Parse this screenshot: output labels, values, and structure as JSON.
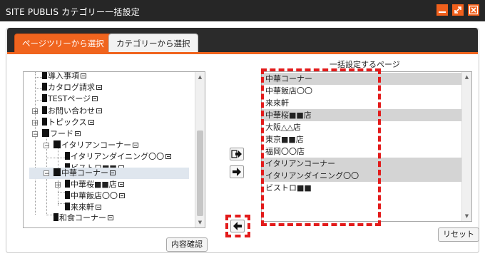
{
  "window": {
    "title": "SITE PUBLIS カテゴリー一括設定",
    "colors": {
      "titlebar": "#262626",
      "accent": "#f0641e",
      "dashed": "#e31b1b"
    }
  },
  "tabs": [
    {
      "label": "ページツリーから選択",
      "active": true
    },
    {
      "label": "カテゴリーから選択",
      "active": false
    }
  ],
  "tree": {
    "items": [
      {
        "label": "導入事項",
        "expander": "",
        "folder": false
      },
      {
        "label": "カタログ請求",
        "expander": "",
        "folder": false
      },
      {
        "label": "TESTページ",
        "expander": "",
        "folder": false
      },
      {
        "label": "お問い合わせ",
        "expander": "+",
        "folder": false
      },
      {
        "label": "トピックス",
        "expander": "+",
        "folder": false
      },
      {
        "label": "フード",
        "expander": "−",
        "folder": true
      },
      {
        "label": "イタリアンコーナー",
        "expander": "−",
        "folder": true
      },
      {
        "label": "イタリアンダイニング〇〇",
        "expander": "",
        "folder": false
      },
      {
        "label": "ビストロ■■",
        "expander": "",
        "folder": false
      },
      {
        "label": "中華コーナー",
        "expander": "−",
        "folder": true,
        "selected": true
      },
      {
        "label": "中華桜■■店",
        "expander": "+",
        "folder": false
      },
      {
        "label": "中華飯店〇〇",
        "expander": "",
        "folder": false
      },
      {
        "label": "来來軒",
        "expander": "",
        "folder": false
      },
      {
        "label": "和食コーナー",
        "expander": "",
        "folder": false
      }
    ]
  },
  "buttons": {
    "add_page": "➡",
    "add_all": "➡",
    "remove": "⬅",
    "confirm": "内容確認",
    "reset": "リセット"
  },
  "list": {
    "caption": "一括設定するページ",
    "items": [
      {
        "label": "中華コーナー",
        "highlight": true
      },
      {
        "label": "中華飯店〇〇",
        "highlight": false
      },
      {
        "label": "来來軒",
        "highlight": false
      },
      {
        "label": "中華桜■■店",
        "highlight": true
      },
      {
        "label": "大阪△△店",
        "highlight": false
      },
      {
        "label": "東京■■店",
        "highlight": false
      },
      {
        "label": "福岡〇〇店",
        "highlight": false
      },
      {
        "label": "イタリアンコーナー",
        "highlight": true
      },
      {
        "label": "イタリアンダイニング〇〇",
        "highlight": true
      },
      {
        "label": "ビストロ■■",
        "highlight": false
      }
    ]
  },
  "icons": {
    "minimize": "minimize-icon",
    "maximize": "maximize-icon",
    "close": "close-icon",
    "page": "page-icon",
    "folder": "folder-icon"
  }
}
